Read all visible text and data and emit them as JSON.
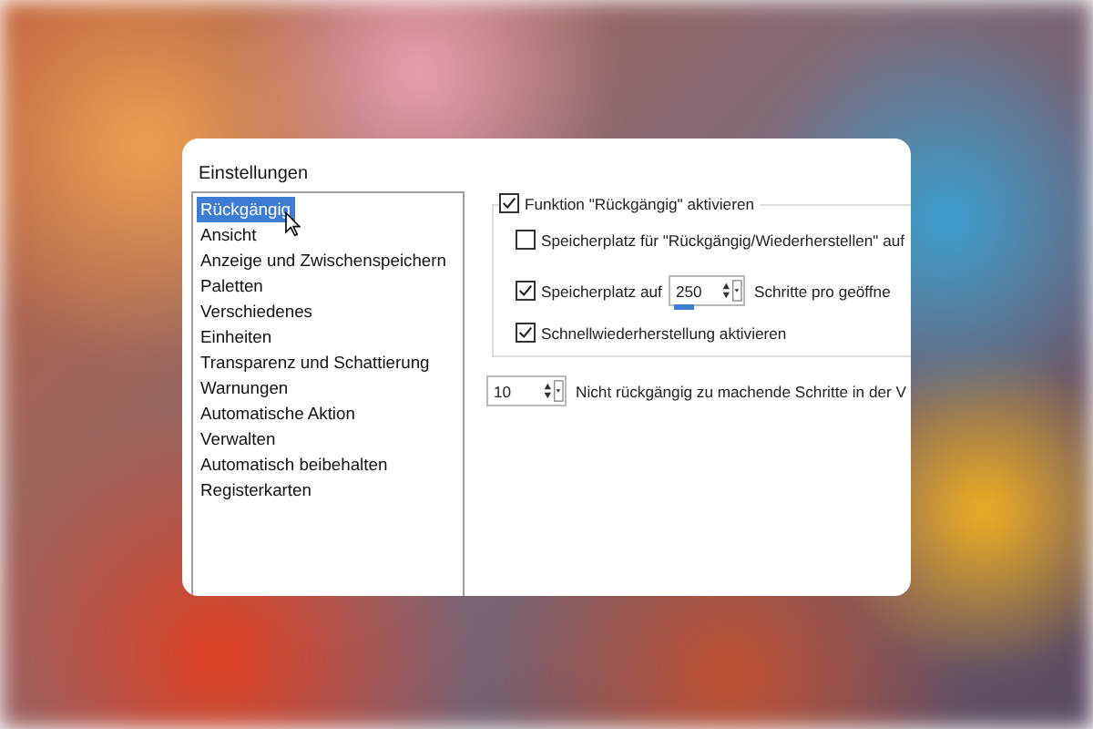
{
  "dialog": {
    "title": "Einstellungen"
  },
  "categories": [
    {
      "label": "Rückgängig",
      "selected": true
    },
    {
      "label": "Ansicht",
      "selected": false
    },
    {
      "label": "Anzeige und Zwischenspeichern",
      "selected": false
    },
    {
      "label": "Paletten",
      "selected": false
    },
    {
      "label": "Verschiedenes",
      "selected": false
    },
    {
      "label": "Einheiten",
      "selected": false
    },
    {
      "label": "Transparenz und Schattierung",
      "selected": false
    },
    {
      "label": "Warnungen",
      "selected": false
    },
    {
      "label": "Automatische Aktion",
      "selected": false
    },
    {
      "label": "Verwalten",
      "selected": false
    },
    {
      "label": "Automatisch beibehalten",
      "selected": false
    },
    {
      "label": "Registerkarten",
      "selected": false
    }
  ],
  "group": {
    "label": "Funktion \"Rückgängig\" aktivieren",
    "checked": true,
    "options": [
      {
        "kind": "checkbox",
        "label": "Speicherplatz für \"Rückgängig/Wiederherstellen\" auf",
        "checked": false
      },
      {
        "kind": "spin",
        "label": "Speicherplatz auf",
        "checked": true,
        "value": "250",
        "suffix": "Schritte pro geöffne"
      },
      {
        "kind": "checkbox",
        "label": "Schnellwiederherstellung aktivieren",
        "checked": true
      }
    ]
  },
  "steps": {
    "value": "10",
    "label": "Nicht rückgängig zu machende Schritte in der V"
  }
}
